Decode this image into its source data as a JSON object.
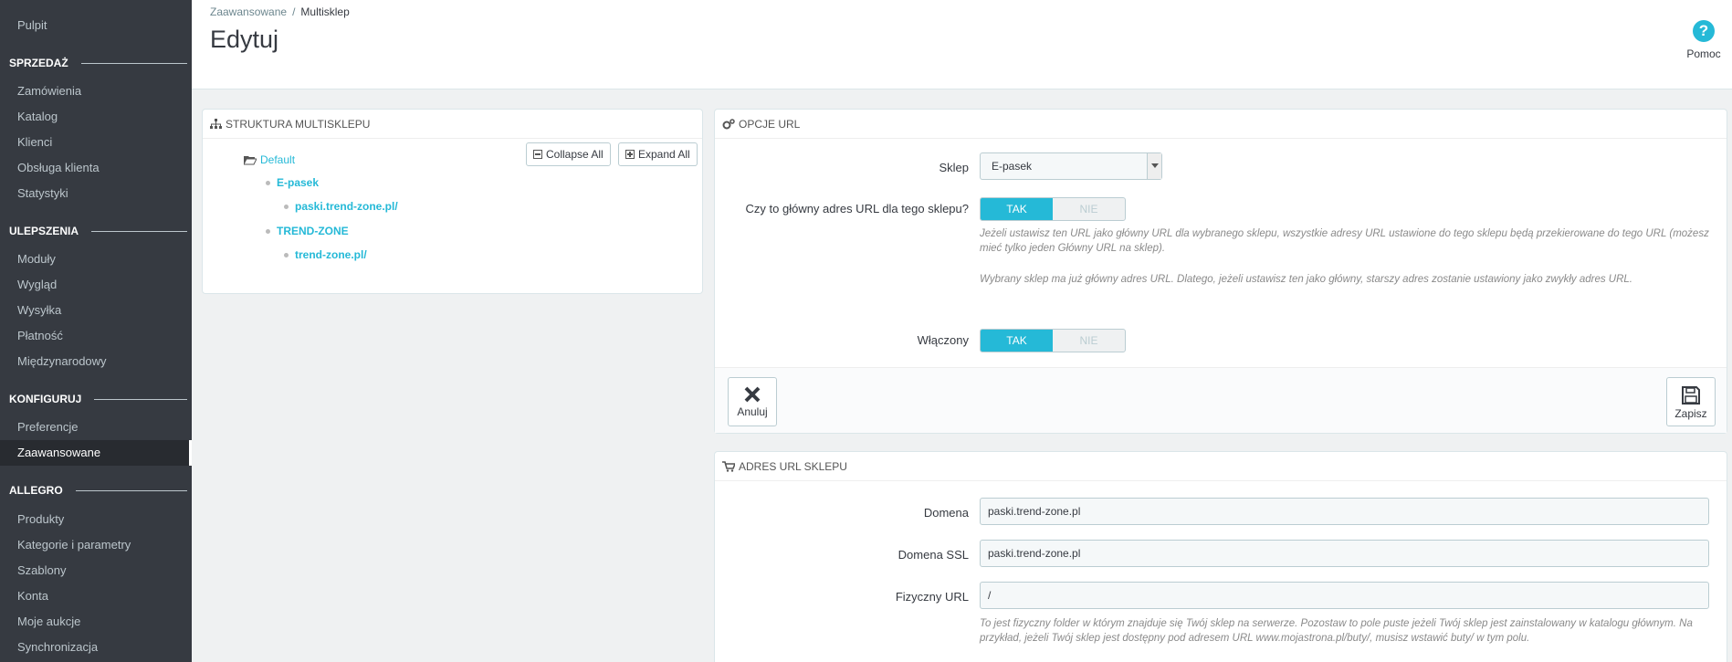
{
  "sidebar": {
    "items": [
      {
        "label": "Pulpit"
      },
      {
        "section": "SPRZEDAŻ"
      },
      {
        "label": "Zamówienia"
      },
      {
        "label": "Katalog"
      },
      {
        "label": "Klienci"
      },
      {
        "label": "Obsługa klienta"
      },
      {
        "label": "Statystyki"
      },
      {
        "section": "ULEPSZENIA"
      },
      {
        "label": "Moduły"
      },
      {
        "label": "Wygląd"
      },
      {
        "label": "Wysyłka"
      },
      {
        "label": "Płatność"
      },
      {
        "label": "Międzynarodowy"
      },
      {
        "section": "KONFIGURUJ"
      },
      {
        "label": "Preferencje"
      },
      {
        "label": "Zaawansowane",
        "active": true
      },
      {
        "section": "ALLEGRO"
      },
      {
        "label": "Produkty"
      },
      {
        "label": "Kategorie i parametry"
      },
      {
        "label": "Szablony"
      },
      {
        "label": "Konta"
      },
      {
        "label": "Moje aukcje"
      },
      {
        "label": "Synchronizacja"
      }
    ]
  },
  "header": {
    "breadcrumb": [
      "Zaawansowane",
      "Multisklep"
    ],
    "title": "Edytuj",
    "help_label": "Pomoc"
  },
  "tree_panel": {
    "title": "STRUKTURA MULTISKLEPU",
    "collapse_label": "Collapse All",
    "expand_label": "Expand All",
    "root": "Default",
    "shops": [
      {
        "name": "E-pasek",
        "url": "paski.trend-zone.pl/"
      },
      {
        "name": "TREND-ZONE",
        "url": "trend-zone.pl/"
      }
    ]
  },
  "url_panel": {
    "title": "OPCJE URL",
    "shop_label": "Sklep",
    "shop_value": "E-pasek",
    "main_label": "Czy to główny adres URL dla tego sklepu?",
    "yes": "TAK",
    "no": "NIE",
    "main_help1": "Jeżeli ustawisz ten URL jako główny URL dla wybranego sklepu, wszystkie adresy URL ustawione do tego sklepu będą przekierowane do tego URL (możesz mieć tylko jeden Główny URL na sklep).",
    "main_help2": "Wybrany sklep ma już główny adres URL. Dlatego, jeżeli ustawisz ten jako główny, starszy adres zostanie ustawiony jako zwykły adres URL.",
    "enabled_label": "Włączony",
    "cancel_label": "Anuluj",
    "save_label": "Zapisz"
  },
  "address_panel": {
    "title": "ADRES URL SKLEPU",
    "domain_label": "Domena",
    "domain_value": "paski.trend-zone.pl",
    "domain_ssl_label": "Domena SSL",
    "domain_ssl_value": "paski.trend-zone.pl",
    "physical_label": "Fizyczny URL",
    "physical_value": "/",
    "physical_help": "To jest fizyczny folder w którym znajduje się Twój sklep na serwerze. Pozostaw to pole puste jeżeli Twój sklep jest zainstalowany w katalogu głównym. Na przykład, jeżeli Twój sklep jest dostępny pod adresem URL www.mojastrona.pl/buty/, musisz wstawić buty/ w tym polu."
  },
  "colors": {
    "sidebar_bg": "#363a41",
    "accent": "#25b9d7"
  }
}
